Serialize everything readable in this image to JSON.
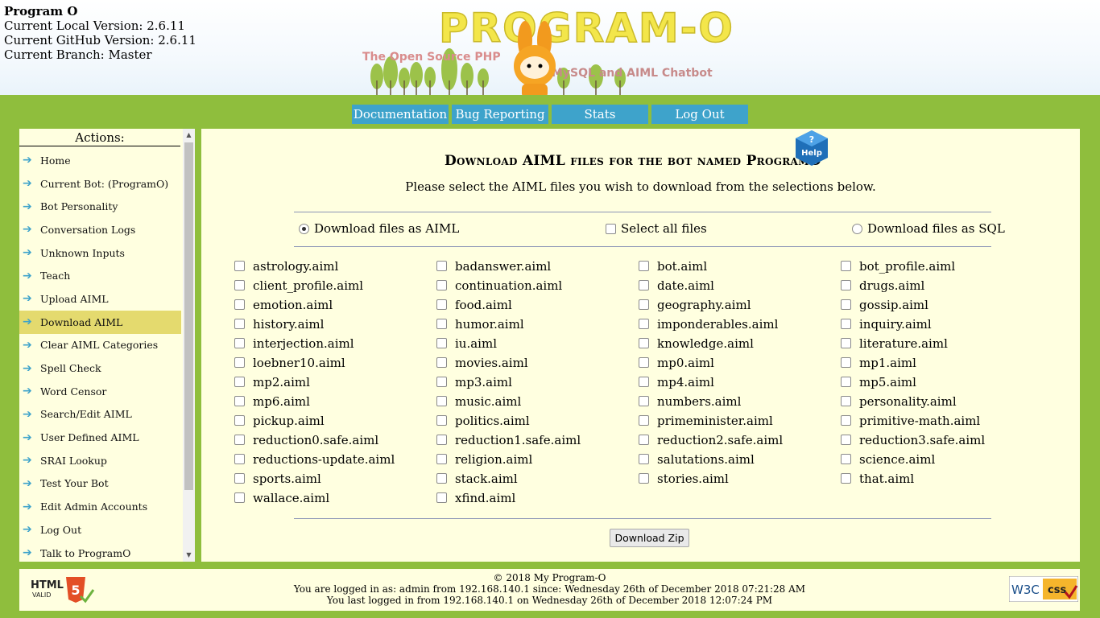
{
  "version_info": {
    "title": "Program O",
    "local_version": "Current Local Version: 2.6.11",
    "github_version": "Current GitHub Version: 2.6.11",
    "branch": "Current Branch: Master"
  },
  "logo": {
    "name": "PROGRAM-O",
    "tagline_left": "The Open Source PHP",
    "tagline_right": "MySQL and AIML Chatbot"
  },
  "top_nav": [
    "Documentation",
    "Bug Reporting",
    "Stats",
    "Log Out"
  ],
  "sidebar": {
    "heading": "Actions:",
    "active_index": 7,
    "items": [
      "Home",
      "Current Bot: (ProgramO)",
      "Bot Personality",
      "Conversation Logs",
      "Unknown Inputs",
      "Teach",
      "Upload AIML",
      "Download AIML",
      "Clear AIML Categories",
      "Spell Check",
      "Word Censor",
      "Search/Edit AIML",
      "User Defined AIML",
      "SRAI Lookup",
      "Test Your Bot",
      "Edit Admin Accounts",
      "Log Out",
      "Talk to ProgramO"
    ]
  },
  "main": {
    "title": "Download AIML files for the bot named ProgramO",
    "help_label": "Help",
    "subtitle": "Please select the AIML files you wish to download from the selections below.",
    "options": {
      "aiml_label": "Download files as AIML",
      "select_all_label": "Select all files",
      "sql_label": "Download files as SQL",
      "selected_format": "AIML"
    },
    "files": [
      "astrology.aiml",
      "badanswer.aiml",
      "bot.aiml",
      "bot_profile.aiml",
      "client_profile.aiml",
      "continuation.aiml",
      "date.aiml",
      "drugs.aiml",
      "emotion.aiml",
      "food.aiml",
      "geography.aiml",
      "gossip.aiml",
      "history.aiml",
      "humor.aiml",
      "imponderables.aiml",
      "inquiry.aiml",
      "interjection.aiml",
      "iu.aiml",
      "knowledge.aiml",
      "literature.aiml",
      "loebner10.aiml",
      "movies.aiml",
      "mp0.aiml",
      "mp1.aiml",
      "mp2.aiml",
      "mp3.aiml",
      "mp4.aiml",
      "mp5.aiml",
      "mp6.aiml",
      "music.aiml",
      "numbers.aiml",
      "personality.aiml",
      "pickup.aiml",
      "politics.aiml",
      "primeminister.aiml",
      "primitive-math.aiml",
      "reduction0.safe.aiml",
      "reduction1.safe.aiml",
      "reduction2.safe.aiml",
      "reduction3.safe.aiml",
      "reductions-update.aiml",
      "religion.aiml",
      "salutations.aiml",
      "science.aiml",
      "sports.aiml",
      "stack.aiml",
      "stories.aiml",
      "that.aiml",
      "wallace.aiml",
      "xfind.aiml"
    ],
    "download_button": "Download Zip"
  },
  "footer": {
    "copyright": "© 2018 My Program-O",
    "logged_in": "You are logged in as: admin from 192.168.140.1 since: Wednesday 26th of December 2018 07:21:28 AM",
    "last_login": "You last logged in from 192.168.140.1 on Wednesday 26th of December 2018 12:07:24 PM",
    "html_badge": "HTML",
    "html_badge_sub": "VALID",
    "css_badge": "css"
  },
  "colors": {
    "grass": "#8fbe3d",
    "panel": "#ffffe0",
    "nav_button": "#3ea3cb",
    "active_item": "#e4da6e"
  }
}
